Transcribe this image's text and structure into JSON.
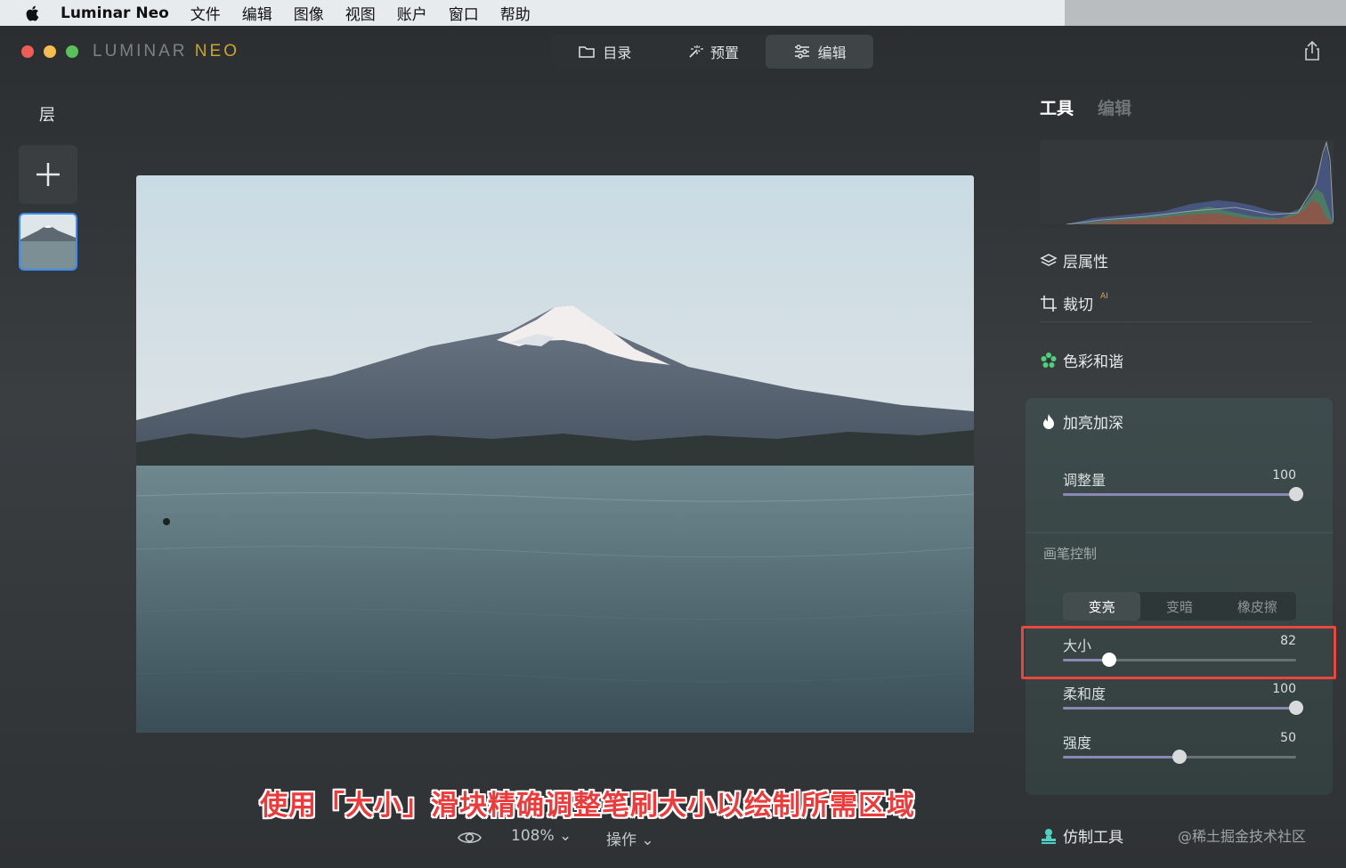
{
  "menubar": {
    "app_name": "Luminar Neo",
    "items": [
      "文件",
      "编辑",
      "图像",
      "视图",
      "账户",
      "窗口",
      "帮助"
    ]
  },
  "window": {
    "brand_main": "LUMINAR",
    "brand_accent": "NEO",
    "nav": {
      "catalog": "目录",
      "presets": "预置",
      "edit": "编辑"
    }
  },
  "layers": {
    "title": "层"
  },
  "canvas": {
    "zoom": "108%",
    "actions": "操作",
    "caption": "使用「大小」滑块精确调整笔刷大小以绘制所需区域"
  },
  "panel": {
    "tab_tools": "工具",
    "tab_edit": "编辑",
    "layer_props": "层属性",
    "crop": "裁切",
    "crop_badge": "AI",
    "color_harmony": "色彩和谐",
    "dodge_burn": "加亮加深",
    "amount": {
      "label": "调整量",
      "value": "100",
      "level": 1.0
    },
    "brush_control": "画笔控制",
    "modes": {
      "lighten": "变亮",
      "darken": "变暗",
      "eraser": "橡皮擦"
    },
    "size": {
      "label": "大小",
      "value": "82",
      "level": 0.2
    },
    "softness": {
      "label": "柔和度",
      "value": "100",
      "level": 1.0
    },
    "strength": {
      "label": "强度",
      "value": "50",
      "level": 0.5
    },
    "clone_tool": "仿制工具"
  },
  "watermark": "@稀土掘金技术社区",
  "colors": {
    "accent_highlight": "#e8463e",
    "selection_blue": "#3d8bf0",
    "harmony_green": "#4fd07a"
  }
}
